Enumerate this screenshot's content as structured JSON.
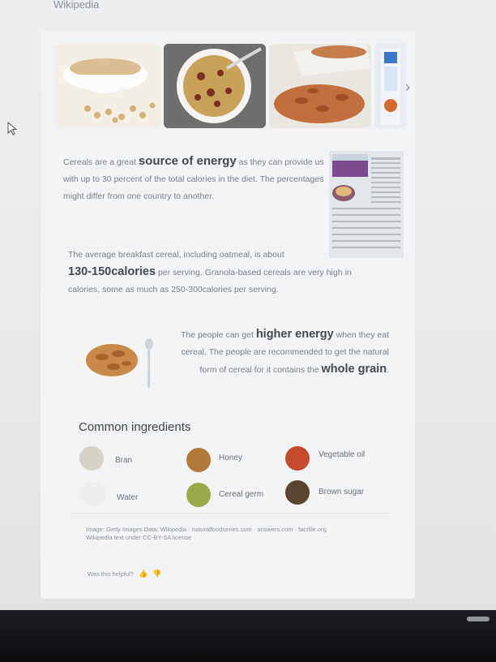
{
  "header": {
    "source_title": "Wikipedia"
  },
  "carousel": {
    "images": [
      {
        "icon": "bowl-of-oat-cereal-image"
      },
      {
        "icon": "bowl-of-granola-image"
      },
      {
        "icon": "spilled-cereal-flakes-image"
      },
      {
        "icon": "cereal-box-image"
      }
    ],
    "next_icon": "chevron-right-icon"
  },
  "paragraphs": {
    "p1": {
      "a": "Cereals are a great ",
      "b": "source of energy",
      "c": " as they can provide us with up to 30 percent of the total calories in the diet. The percentages might differ from one country to another."
    },
    "p2": {
      "a": "The average breakfast cereal, including oatmeal, is about ",
      "b": "130-150calories",
      "c": " per serving. Granola-based cereals are very high in calories, some as much as 250-300calories per serving."
    },
    "p3": {
      "a": "The people can get ",
      "b": "higher energy",
      "c": " when they eat cereal. The people are recommended to get the natural form of cereal for it contains the ",
      "d": "whole grain",
      "e": "."
    }
  },
  "ingredients": {
    "title": "Common ingredients",
    "items": [
      {
        "label": "Bran",
        "icon": "bran-icon",
        "color": "#cfc9bd"
      },
      {
        "label": "Honey",
        "icon": "honey-icon",
        "color": "#b07a3a"
      },
      {
        "label": "Vegetable oil",
        "icon": "vegetable-oil-icon",
        "color": "#c44b2d"
      },
      {
        "label": "Water",
        "icon": "water-icon",
        "color": "#e9ecef"
      },
      {
        "label": "Cereal germ",
        "icon": "cereal-germ-icon",
        "color": "#9aa94a"
      },
      {
        "label": "Brown sugar",
        "icon": "brown-sugar-icon",
        "color": "#5a4530"
      }
    ]
  },
  "footer": {
    "images_line": "Image: Getty Images  Data: Wikipedia · naturalfoodseries.com · answers.com · factfile.org",
    "license_line": "Wikipedia text under CC-BY-SA license",
    "helpful_label": "Was this helpful?",
    "thumbs_up_icon": "thumbs-up-icon",
    "thumbs_down_icon": "thumbs-down-icon"
  }
}
